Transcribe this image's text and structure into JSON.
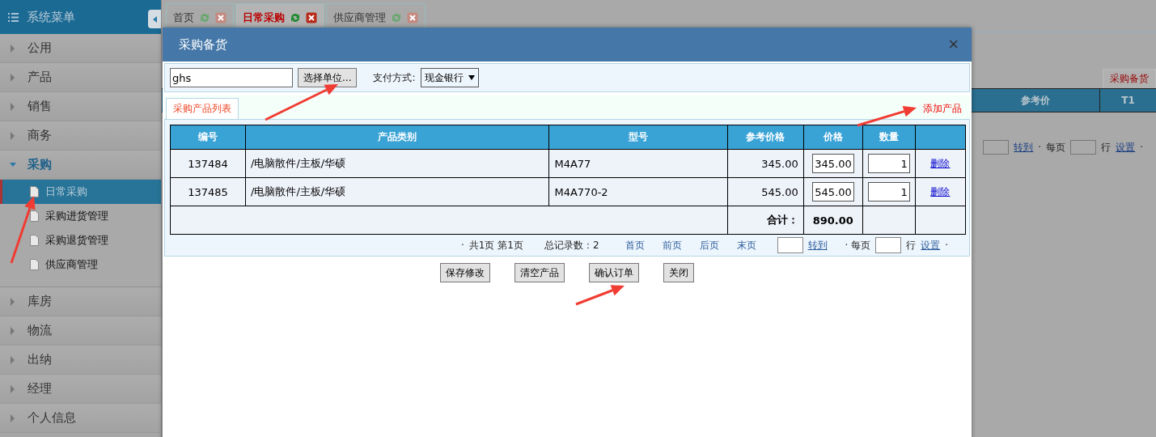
{
  "sidebar": {
    "title": "系统菜单",
    "groups": [
      {
        "label": "公用",
        "expanded": false
      },
      {
        "label": "产品",
        "expanded": false
      },
      {
        "label": "销售",
        "expanded": false
      },
      {
        "label": "商务",
        "expanded": false
      },
      {
        "label": "采购",
        "expanded": true,
        "children": [
          {
            "label": "日常采购",
            "selected": true
          },
          {
            "label": "采购进货管理",
            "selected": false
          },
          {
            "label": "采购退货管理",
            "selected": false
          },
          {
            "label": "供应商管理",
            "selected": false
          }
        ]
      },
      {
        "label": "库房",
        "expanded": false
      },
      {
        "label": "物流",
        "expanded": false
      },
      {
        "label": "出纳",
        "expanded": false
      },
      {
        "label": "经理",
        "expanded": false
      },
      {
        "label": "个人信息",
        "expanded": false
      }
    ]
  },
  "tabs": [
    {
      "label": "首页",
      "selected": false
    },
    {
      "label": "日常采购",
      "selected": true
    },
    {
      "label": "供应商管理",
      "selected": false
    }
  ],
  "background_page": {
    "tab": "采购备货",
    "columns": [
      "参考价",
      "T1"
    ],
    "pager": [
      "转到",
      "·",
      "每页",
      "行",
      "设置",
      "·"
    ]
  },
  "dialog": {
    "title": "采购备货",
    "close": "×",
    "supplier_field": {
      "value": "ghs"
    },
    "choose_button": "选择单位...",
    "payment_label": "支付方式:",
    "payment_select": "现金银行",
    "list_tab": "采购产品列表",
    "add_link": "添加产品",
    "table": {
      "columns": [
        "编号",
        "产品类别",
        "型号",
        "参考价格",
        "价格",
        "数量"
      ],
      "rows": [
        {
          "id": "137484",
          "category": "/电脑散件/主板/华硕",
          "model": "M4A77",
          "ref_price": "345.00",
          "price": "345.00",
          "qty": "1",
          "action": "删除"
        },
        {
          "id": "137485",
          "category": "/电脑散件/主板/华硕",
          "model": "M4A770-2",
          "ref_price": "545.00",
          "price": "545.00",
          "qty": "1",
          "action": "删除"
        }
      ],
      "total_label": "合计：",
      "total": "890.00"
    },
    "pager": {
      "dot": "·",
      "pages": "共1页 第1页",
      "records": "总记录数：2",
      "links": [
        "首页",
        "前页",
        "后页",
        "末页"
      ],
      "goto": "转到",
      "per_page_prefix": "· 每页",
      "per_page_suffix": "行",
      "settings": "设置",
      "end_dot": "·"
    },
    "buttons": [
      "保存修改",
      "清空产品",
      "确认订单",
      "关闭"
    ]
  }
}
